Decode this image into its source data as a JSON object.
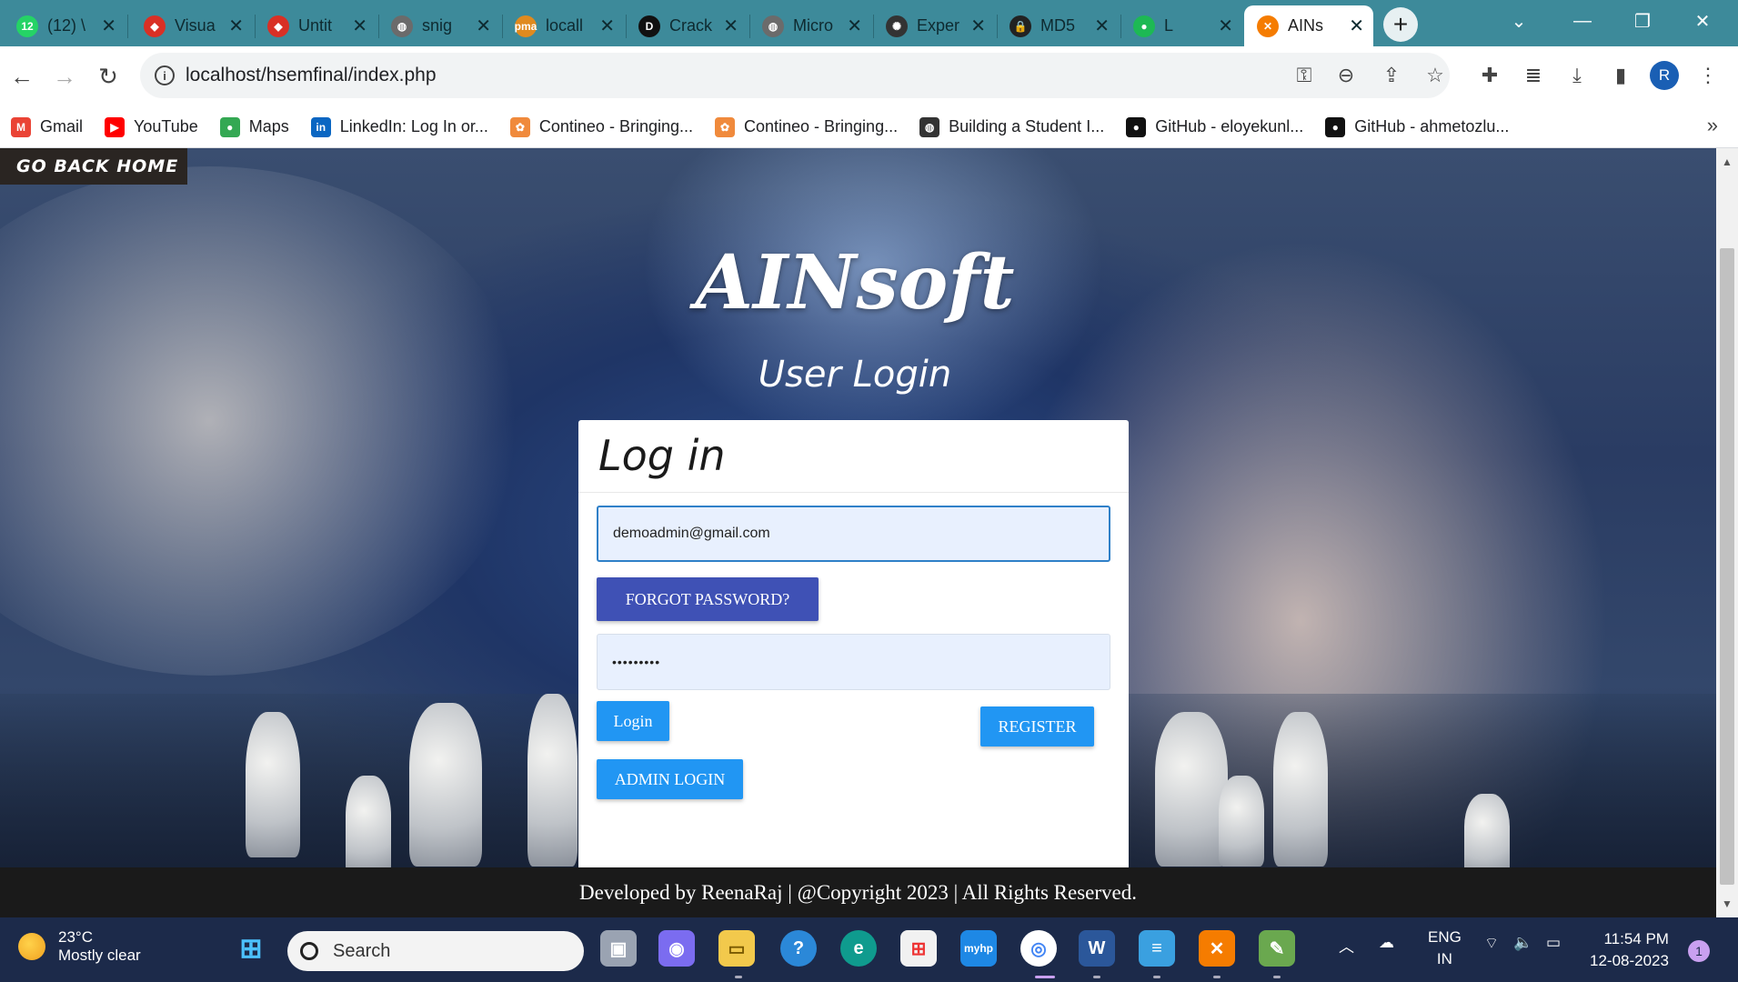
{
  "browser": {
    "tabs": [
      {
        "title": "(12) \\",
        "favicon": "whatsapp-icon",
        "color": "#25d366",
        "glyph": "12"
      },
      {
        "title": "Visua",
        "favicon": "diamond-icon",
        "color": "#d93025",
        "glyph": "◆"
      },
      {
        "title": "Untit",
        "favicon": "diamond-icon",
        "color": "#d93025",
        "glyph": "◆"
      },
      {
        "title": "snig",
        "favicon": "globe-icon",
        "color": "#6b6b6b",
        "glyph": "◍"
      },
      {
        "title": "locall",
        "favicon": "phpmyadmin-icon",
        "color": "#e08a1e",
        "glyph": "pma"
      },
      {
        "title": "Crack",
        "favicon": "d-logo-icon",
        "color": "#111111",
        "glyph": "D"
      },
      {
        "title": "Micro",
        "favicon": "globe-icon",
        "color": "#6b6b6b",
        "glyph": "◍"
      },
      {
        "title": "Exper",
        "favicon": "openai-icon",
        "color": "#333333",
        "glyph": "✺"
      },
      {
        "title": "MD5",
        "favicon": "lock-icon",
        "color": "#222222",
        "glyph": "🔒"
      },
      {
        "title": "L",
        "favicon": "spotify-icon",
        "color": "#1db954",
        "glyph": "●"
      },
      {
        "title": "AINs",
        "favicon": "xampp-icon",
        "color": "#f57c00",
        "glyph": "✕",
        "active": true
      }
    ],
    "new_tab_label": "+",
    "url": "localhost/hsemfinal/index.php",
    "profile_initial": "R"
  },
  "bookmarks": [
    {
      "label": "Gmail",
      "icon": "gmail-icon",
      "color": "#ea4335",
      "glyph": "M"
    },
    {
      "label": "YouTube",
      "icon": "youtube-icon",
      "color": "#ff0000",
      "glyph": "▶"
    },
    {
      "label": "Maps",
      "icon": "maps-pin-icon",
      "color": "#34a853",
      "glyph": "●"
    },
    {
      "label": "LinkedIn: Log In or...",
      "icon": "linkedin-icon",
      "color": "#0a66c2",
      "glyph": "in"
    },
    {
      "label": "Contineo - Bringing...",
      "icon": "contineo-icon",
      "color": "#f08a3c",
      "glyph": "✿"
    },
    {
      "label": "Contineo - Bringing...",
      "icon": "contineo-icon",
      "color": "#f08a3c",
      "glyph": "✿"
    },
    {
      "label": "Building a Student I...",
      "icon": "globe-icon",
      "color": "#333333",
      "glyph": "◍"
    },
    {
      "label": "GitHub - eloyekunl...",
      "icon": "github-icon",
      "color": "#111111",
      "glyph": "●"
    },
    {
      "label": "GitHub - ahmetozlu...",
      "icon": "github-icon",
      "color": "#111111",
      "glyph": "●"
    }
  ],
  "page": {
    "back_home": "GO BACK HOME",
    "brand": "AINsoft",
    "subtitle": "User Login",
    "card_title": "Log in",
    "email_value": "demoadmin@gmail.com",
    "forgot_password": "FORGOT PASSWORD?",
    "password_value": "•••••••••",
    "login": "Login",
    "register": "REGISTER",
    "admin_login": "ADMIN LOGIN",
    "footer": "Developed by ReenaRaj | @Copyright 2023 | All Rights Reserved."
  },
  "taskbar": {
    "temperature": "23°C",
    "condition": "Mostly clear",
    "search_placeholder": "Search",
    "language": "ENG",
    "region": "IN",
    "time": "11:54 PM",
    "date": "12-08-2023",
    "notifications": "1"
  }
}
